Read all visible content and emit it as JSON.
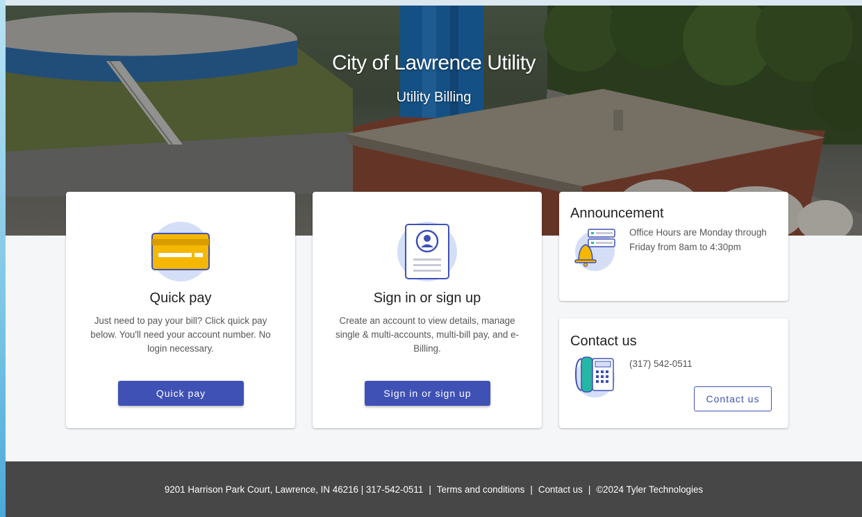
{
  "hero": {
    "title": "City of Lawrence Utility",
    "subtitle": "Utility Billing"
  },
  "quick_pay": {
    "icon": "credit-card-icon",
    "title": "Quick pay",
    "description": "Just need to pay your bill? Click quick pay below. You'll need your account number. No login necessary.",
    "button_label": "Quick pay"
  },
  "sign_in": {
    "icon": "account-profile-icon",
    "title": "Sign in or sign up",
    "description": "Create an account to view details, manage single & multi-accounts, multi-bill pay, and e-Billing.",
    "button_label": "Sign in or sign up"
  },
  "announcement": {
    "icon": "bell-announcement-icon",
    "title": "Announcement",
    "text": "Office Hours are Monday through Friday from 8am to 4:30pm"
  },
  "contact": {
    "icon": "desk-phone-icon",
    "title": "Contact us",
    "phone": "(317) 542-0511",
    "button_label": "Contact us"
  },
  "footer": {
    "address": "9201 Harrison Park Court, Lawrence, IN 46216 | 317-542-0511",
    "terms_link": "Terms and conditions",
    "contact_link": "Contact us",
    "copyright": "©2024 Tyler Technologies"
  },
  "colors": {
    "primary": "#3f51b5",
    "icon_circle": "#d4dff7",
    "card_yellow": "#f5b700",
    "footer_bg": "#474747"
  }
}
